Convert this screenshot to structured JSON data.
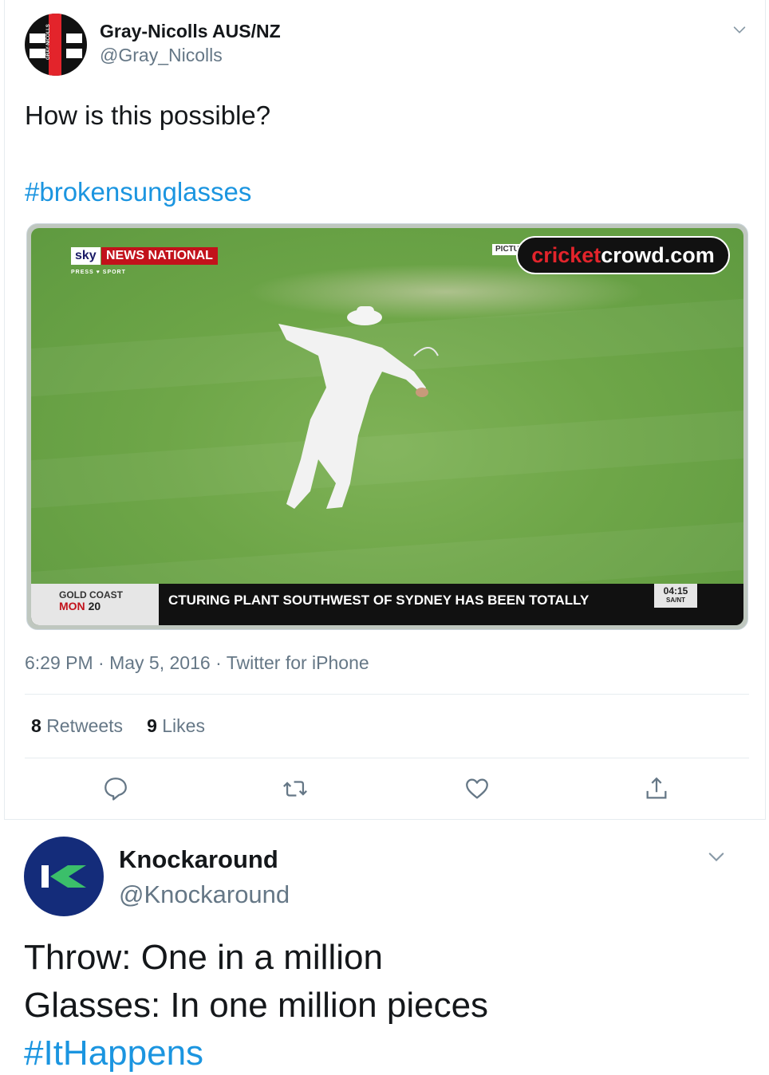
{
  "tweet1": {
    "display_name": "Gray-Nicolls AUS/NZ",
    "handle": "@Gray_Nicolls",
    "avatar_text": "GRAY-NICOLLS",
    "text": "How is this possible?",
    "hashtag": "#brokensunglasses",
    "media": {
      "sky_label": "sky",
      "channel_label": "NEWS NATIONAL",
      "sub_label": "PRESS ♥ SPORT",
      "pictur_label": "PICTUR",
      "watermark_prefix": "cricket",
      "watermark_suffix": "crowd.com",
      "location_line1": "GOLD COAST",
      "location_line2_day": "MON",
      "location_line2_date": "20",
      "ticker_text": "CTURING PLANT SOUTHWEST OF SYDNEY HAS BEEN TOTALLY",
      "clock_time": "04:15",
      "clock_zone": "SA/NT"
    },
    "meta": "6:29 PM · May 5, 2016 · Twitter for iPhone",
    "retweets_count": "8",
    "retweets_label": "Retweets",
    "likes_count": "9",
    "likes_label": "Likes",
    "colors": {
      "link": "#1b95e0",
      "muted": "#657786",
      "border": "#e6ecf0"
    }
  },
  "tweet2": {
    "display_name": "Knockaround",
    "handle": "@Knockaround",
    "avatar_text": "K",
    "line1": "Throw: One in a million",
    "line2": "Glasses: In one million pieces",
    "hashtag": "#ItHappens",
    "colors": {
      "avatar_bg": "#142c7a",
      "avatar_accent": "#3bbf6a"
    }
  },
  "icons": {
    "chevron": "chevron-down-icon",
    "reply": "reply-icon",
    "retweet": "retweet-icon",
    "like": "heart-icon",
    "share": "share-icon"
  }
}
